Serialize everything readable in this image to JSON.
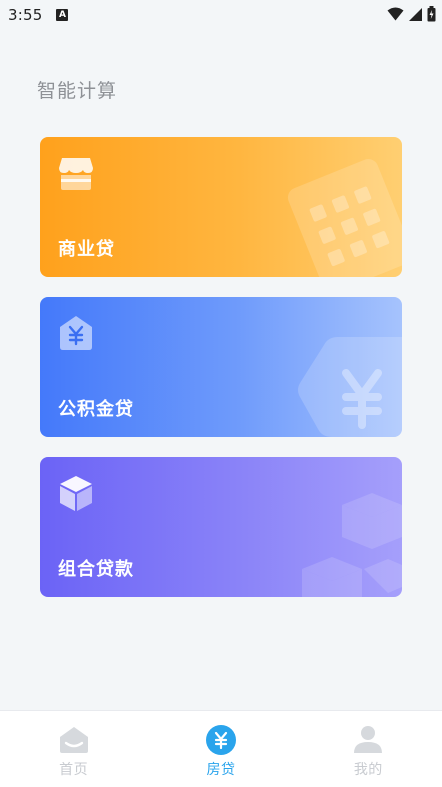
{
  "status_bar": {
    "time": "3:55",
    "notification_glyph": "A"
  },
  "section_title": "智能计算",
  "cards": [
    {
      "label": "商业贷",
      "icon": "shop-icon",
      "color": "#ffa11c"
    },
    {
      "label": "公积金贷",
      "icon": "yuan-house-icon",
      "color": "#4479fa"
    },
    {
      "label": "组合贷款",
      "icon": "cube-icon",
      "color": "#6b63f6"
    }
  ],
  "tabbar": {
    "items": [
      {
        "label": "首页",
        "icon": "home-icon",
        "active": false
      },
      {
        "label": "房贷",
        "icon": "yuan-circle-icon",
        "active": true
      },
      {
        "label": "我的",
        "icon": "user-icon",
        "active": false
      }
    ],
    "active_color": "#2aa4ec",
    "inactive_color": "#c8cbd0"
  }
}
